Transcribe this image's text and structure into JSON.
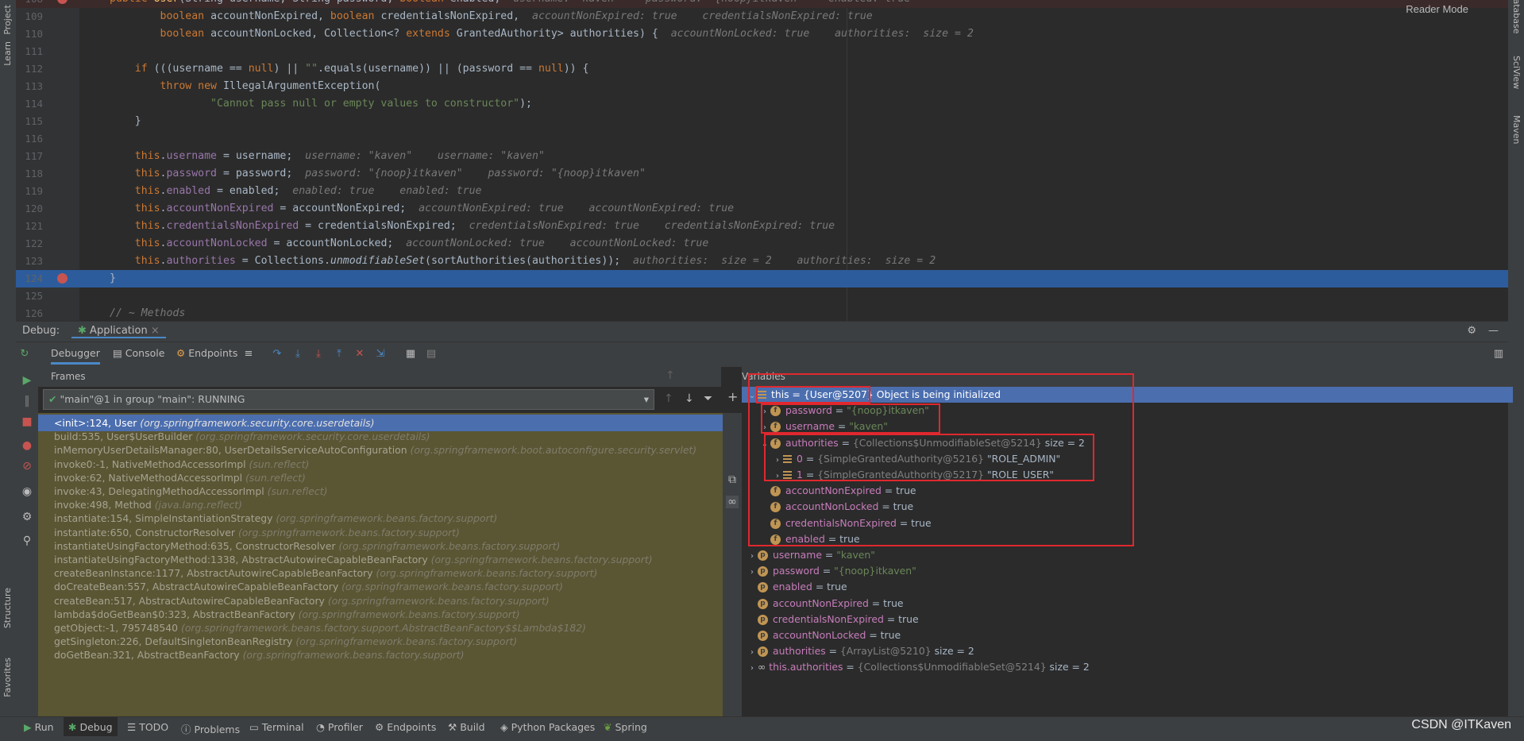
{
  "editor": {
    "reader_mode": "Reader Mode",
    "lines": [
      {
        "n": "108",
        "parts": [
          [
            "kw",
            "public "
          ],
          [
            "fn",
            "User"
          ],
          [
            "",
            "("
          ],
          [
            "",
            "String username, String password, "
          ],
          [
            "kw",
            "boolean "
          ],
          [
            "",
            "enabled,  "
          ],
          [
            "hint",
            "username: \"kaven\"    password: \"{noop}itkaven\"    enabled: true"
          ]
        ]
      },
      {
        "n": "109",
        "parts": [
          [
            "",
            "        "
          ],
          [
            "kw",
            "boolean "
          ],
          [
            "",
            "accountNonExpired, "
          ],
          [
            "kw",
            "boolean "
          ],
          [
            "",
            "credentialsNonExpired,  "
          ],
          [
            "hint",
            "accountNonExpired: true    credentialsNonExpired: true"
          ]
        ]
      },
      {
        "n": "110",
        "parts": [
          [
            "",
            "        "
          ],
          [
            "kw",
            "boolean "
          ],
          [
            "",
            "accountNonLocked, Collection<? "
          ],
          [
            "kw",
            "extends "
          ],
          [
            "",
            "GrantedAuthority> authorities) {  "
          ],
          [
            "hint",
            "accountNonLocked: true    authorities:  size = 2"
          ]
        ]
      },
      {
        "n": "111",
        "parts": []
      },
      {
        "n": "112",
        "parts": [
          [
            "",
            "    "
          ],
          [
            "kw",
            "if "
          ],
          [
            "",
            "(((username == "
          ],
          [
            "kw",
            "null"
          ],
          [
            "",
            ") || "
          ],
          [
            "str",
            "\"\""
          ],
          [
            "",
            ".equals(username)) || (password == "
          ],
          [
            "kw",
            "null"
          ],
          [
            "",
            ")) {"
          ]
        ]
      },
      {
        "n": "113",
        "parts": [
          [
            "",
            "        "
          ],
          [
            "kw",
            "throw new "
          ],
          [
            "",
            "IllegalArgumentException("
          ]
        ]
      },
      {
        "n": "114",
        "parts": [
          [
            "",
            "                "
          ],
          [
            "str",
            "\"Cannot pass null or empty values to constructor\""
          ],
          [
            "",
            ");"
          ]
        ]
      },
      {
        "n": "115",
        "parts": [
          [
            "",
            "    }"
          ]
        ]
      },
      {
        "n": "116",
        "parts": []
      },
      {
        "n": "117",
        "parts": [
          [
            "",
            "    "
          ],
          [
            "kw",
            "this"
          ],
          [
            "",
            "."
          ],
          [
            "fld",
            "username"
          ],
          [
            "",
            " = username;  "
          ],
          [
            "hint",
            "username: \"kaven\"    username: \"kaven\""
          ]
        ]
      },
      {
        "n": "118",
        "parts": [
          [
            "",
            "    "
          ],
          [
            "kw",
            "this"
          ],
          [
            "",
            "."
          ],
          [
            "fld",
            "password"
          ],
          [
            "",
            " = password;  "
          ],
          [
            "hint",
            "password: \"{noop}itkaven\"    password: \"{noop}itkaven\""
          ]
        ]
      },
      {
        "n": "119",
        "parts": [
          [
            "",
            "    "
          ],
          [
            "kw",
            "this"
          ],
          [
            "",
            "."
          ],
          [
            "fld",
            "enabled"
          ],
          [
            "",
            " = enabled;  "
          ],
          [
            "hint",
            "enabled: true    enabled: true"
          ]
        ]
      },
      {
        "n": "120",
        "parts": [
          [
            "",
            "    "
          ],
          [
            "kw",
            "this"
          ],
          [
            "",
            "."
          ],
          [
            "fld",
            "accountNonExpired"
          ],
          [
            "",
            " = accountNonExpired;  "
          ],
          [
            "hint",
            "accountNonExpired: true    accountNonExpired: true"
          ]
        ]
      },
      {
        "n": "121",
        "parts": [
          [
            "",
            "    "
          ],
          [
            "kw",
            "this"
          ],
          [
            "",
            "."
          ],
          [
            "fld",
            "credentialsNonExpired"
          ],
          [
            "",
            " = credentialsNonExpired;  "
          ],
          [
            "hint",
            "credentialsNonExpired: true    credentialsNonExpired: true"
          ]
        ]
      },
      {
        "n": "122",
        "parts": [
          [
            "",
            "    "
          ],
          [
            "kw",
            "this"
          ],
          [
            "",
            "."
          ],
          [
            "fld",
            "accountNonLocked"
          ],
          [
            "",
            " = accountNonLocked;  "
          ],
          [
            "hint",
            "accountNonLocked: true    accountNonLocked: true"
          ]
        ]
      },
      {
        "n": "123",
        "parts": [
          [
            "",
            "    "
          ],
          [
            "kw",
            "this"
          ],
          [
            "",
            "."
          ],
          [
            "fld",
            "authorities"
          ],
          [
            "",
            " = Collections."
          ],
          [
            "it",
            "unmodifiableSet"
          ],
          [
            "",
            "(sortAuthorities(authorities));  "
          ],
          [
            "hint",
            "authorities:  size = 2    authorities:  size = 2"
          ]
        ]
      },
      {
        "n": "124",
        "parts": [
          [
            "",
            "}"
          ]
        ]
      },
      {
        "n": "125",
        "parts": []
      },
      {
        "n": "126",
        "parts": [
          [
            "hint",
            "// ~ Methods"
          ]
        ]
      }
    ]
  },
  "debug": {
    "label": "Debug:",
    "config": "Application",
    "tabs": [
      "Debugger",
      "Console",
      "Endpoints"
    ],
    "frames_label": "Frames",
    "variables_label": "Variables",
    "thread": "\"main\"@1 in group \"main\": RUNNING",
    "frames": [
      {
        "m": "<init>:124, User ",
        "p": "(org.springframework.security.core.userdetails)"
      },
      {
        "m": "build:535, User$UserBuilder ",
        "p": "(org.springframework.security.core.userdetails)"
      },
      {
        "m": "inMemoryUserDetailsManager:80, UserDetailsServiceAutoConfiguration ",
        "p": "(org.springframework.boot.autoconfigure.security.servlet)"
      },
      {
        "m": "invoke0:-1, NativeMethodAccessorImpl ",
        "p": "(sun.reflect)"
      },
      {
        "m": "invoke:62, NativeMethodAccessorImpl ",
        "p": "(sun.reflect)"
      },
      {
        "m": "invoke:43, DelegatingMethodAccessorImpl ",
        "p": "(sun.reflect)"
      },
      {
        "m": "invoke:498, Method ",
        "p": "(java.lang.reflect)"
      },
      {
        "m": "instantiate:154, SimpleInstantiationStrategy ",
        "p": "(org.springframework.beans.factory.support)"
      },
      {
        "m": "instantiate:650, ConstructorResolver ",
        "p": "(org.springframework.beans.factory.support)"
      },
      {
        "m": "instantiateUsingFactoryMethod:635, ConstructorResolver ",
        "p": "(org.springframework.beans.factory.support)"
      },
      {
        "m": "instantiateUsingFactoryMethod:1338, AbstractAutowireCapableBeanFactory ",
        "p": "(org.springframework.beans.factory.support)"
      },
      {
        "m": "createBeanInstance:1177, AbstractAutowireCapableBeanFactory ",
        "p": "(org.springframework.beans.factory.support)"
      },
      {
        "m": "doCreateBean:557, AbstractAutowireCapableBeanFactory ",
        "p": "(org.springframework.beans.factory.support)"
      },
      {
        "m": "createBean:517, AbstractAutowireCapableBeanFactory ",
        "p": "(org.springframework.beans.factory.support)"
      },
      {
        "m": "lambda$doGetBean$0:323, AbstractBeanFactory ",
        "p": "(org.springframework.beans.factory.support)"
      },
      {
        "m": "getObject:-1, 795748540 ",
        "p": "(org.springframework.beans.factory.support.AbstractBeanFactory$$Lambda$182)"
      },
      {
        "m": "getSingleton:226, DefaultSingletonBeanRegistry ",
        "p": "(org.springframework.beans.factory.support)"
      },
      {
        "m": "doGetBean:321, AbstractBeanFactory ",
        "p": "(org.springframework.beans.factory.support)"
      }
    ],
    "variables": [
      {
        "indent": 0,
        "chev": "⌄",
        "icon": "bars",
        "name": "this",
        "val": " = {User@5207} ",
        "extra": "Object is being initialized",
        "sel": true
      },
      {
        "indent": 1,
        "chev": "›",
        "icon": "f",
        "name": "password",
        "val": " = ",
        "str": "\"{noop}itkaven\""
      },
      {
        "indent": 1,
        "chev": "›",
        "icon": "f",
        "name": "username",
        "val": " = ",
        "str": "\"kaven\""
      },
      {
        "indent": 1,
        "chev": "⌄",
        "icon": "f",
        "name": "authorities",
        "val": " = ",
        "type": "{Collections$UnmodifiableSet@5214}",
        "extra": "  size = 2"
      },
      {
        "indent": 2,
        "chev": "›",
        "icon": "bars",
        "name": "0",
        "val": " = ",
        "type": "{SimpleGrantedAuthority@5216} ",
        "extra": "\"ROLE_ADMIN\""
      },
      {
        "indent": 2,
        "chev": "›",
        "icon": "bars",
        "name": "1",
        "val": " = ",
        "type": "{SimpleGrantedAuthority@5217} ",
        "extra": "\"ROLE_USER\""
      },
      {
        "indent": 1,
        "chev": "",
        "icon": "f",
        "name": "accountNonExpired",
        "val": " = true"
      },
      {
        "indent": 1,
        "chev": "",
        "icon": "f",
        "name": "accountNonLocked",
        "val": " = true"
      },
      {
        "indent": 1,
        "chev": "",
        "icon": "f",
        "name": "credentialsNonExpired",
        "val": " = true"
      },
      {
        "indent": 1,
        "chev": "",
        "icon": "f",
        "name": "enabled",
        "val": " = true"
      },
      {
        "indent": 0,
        "chev": "›",
        "icon": "p",
        "name": "username",
        "val": " = ",
        "str": "\"kaven\""
      },
      {
        "indent": 0,
        "chev": "›",
        "icon": "p",
        "name": "password",
        "val": " = ",
        "str": "\"{noop}itkaven\""
      },
      {
        "indent": 0,
        "chev": "",
        "icon": "p",
        "name": "enabled",
        "val": " = true"
      },
      {
        "indent": 0,
        "chev": "",
        "icon": "p",
        "name": "accountNonExpired",
        "val": " = true"
      },
      {
        "indent": 0,
        "chev": "",
        "icon": "p",
        "name": "credentialsNonExpired",
        "val": " = true"
      },
      {
        "indent": 0,
        "chev": "",
        "icon": "p",
        "name": "accountNonLocked",
        "val": " = true"
      },
      {
        "indent": 0,
        "chev": "›",
        "icon": "p",
        "name": "authorities",
        "val": " = ",
        "type": "{ArrayList@5210}",
        "extra": "  size = 2"
      },
      {
        "indent": 0,
        "chev": "›",
        "icon": "oo",
        "name": "this.authorities",
        "val": " = ",
        "type": "{Collections$UnmodifiableSet@5214}",
        "extra": "  size = 2"
      }
    ]
  },
  "bottom_tabs": [
    "Run",
    "Debug",
    "TODO",
    "Problems",
    "Terminal",
    "Profiler",
    "Endpoints",
    "Build",
    "Python Packages",
    "Spring"
  ],
  "left_strip": [
    "Project",
    "Learn",
    "Structure",
    "Favorites"
  ],
  "right_strip": [
    "Database",
    "SciView",
    "Maven"
  ],
  "watermark": "CSDN @ITKaven"
}
